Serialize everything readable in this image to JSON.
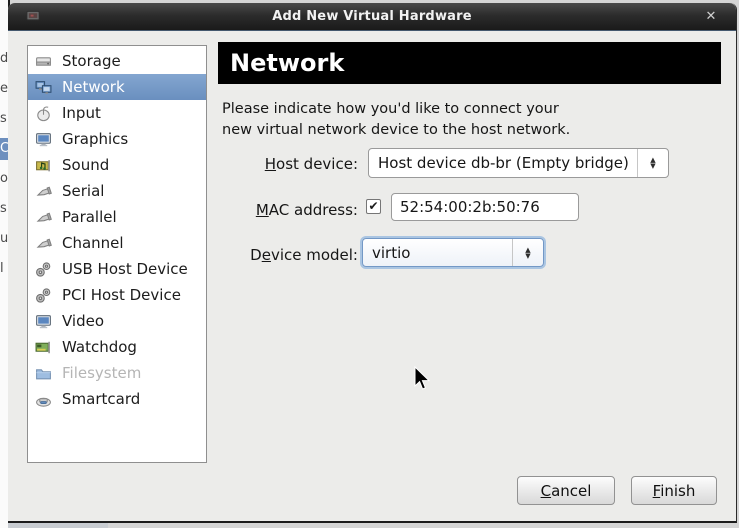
{
  "window": {
    "title": "Add New Virtual Hardware"
  },
  "icons": {
    "close": "✕",
    "checkmark": "✔",
    "spinner_up": "▲",
    "spinner_down": "▼"
  },
  "sidebar": {
    "items": [
      {
        "label": "Storage",
        "icon": "storage-icon",
        "glyph": "storage"
      },
      {
        "label": "Network",
        "icon": "network-icon",
        "glyph": "network",
        "selected": true
      },
      {
        "label": "Input",
        "icon": "input-mouse-icon",
        "glyph": "mouse"
      },
      {
        "label": "Graphics",
        "icon": "graphics-icon",
        "glyph": "monitor"
      },
      {
        "label": "Sound",
        "icon": "sound-icon",
        "glyph": "soundcard"
      },
      {
        "label": "Serial",
        "icon": "serial-icon",
        "glyph": "plug"
      },
      {
        "label": "Parallel",
        "icon": "parallel-icon",
        "glyph": "plug"
      },
      {
        "label": "Channel",
        "icon": "channel-icon",
        "glyph": "plug"
      },
      {
        "label": "USB Host Device",
        "icon": "usb-host-device-icon",
        "glyph": "gears"
      },
      {
        "label": "PCI Host Device",
        "icon": "pci-host-device-icon",
        "glyph": "gears"
      },
      {
        "label": "Video",
        "icon": "video-icon",
        "glyph": "monitor"
      },
      {
        "label": "Watchdog",
        "icon": "watchdog-icon",
        "glyph": "greencard"
      },
      {
        "label": "Filesystem",
        "icon": "filesystem-icon",
        "glyph": "folder",
        "enabled": false
      },
      {
        "label": "Smartcard",
        "icon": "smartcard-icon",
        "glyph": "cardreader"
      }
    ]
  },
  "main": {
    "heading": "Network",
    "instructions_line1": "Please indicate how you'd like to connect your",
    "instructions_line2": "new virtual network device to the host network.",
    "host_device": {
      "label_mn": "H",
      "label_rest": "ost device:",
      "value": "Host device db-br (Empty bridge)"
    },
    "mac_address": {
      "label_mn": "M",
      "label_rest": "AC address:",
      "checked": true,
      "value": "52:54:00:2b:50:76"
    },
    "device_model": {
      "label_pre": "D",
      "label_mn": "e",
      "label_rest": "vice model:",
      "value": "virtio"
    }
  },
  "footer": {
    "cancel_mn": "C",
    "cancel_rest": "ancel",
    "finish_mn": "F",
    "finish_rest": "inish"
  },
  "background": {
    "sliver_fragments": [
      {
        "ch": "d"
      },
      {
        "ch": "e"
      },
      {
        "ch": "s"
      },
      {
        "ch": "C",
        "hl": true
      },
      {
        "ch": "o"
      },
      {
        "ch": "s"
      },
      {
        "ch": "u"
      },
      {
        "ch": "l"
      }
    ]
  },
  "colors": {
    "selection_blue": "#7094c4",
    "banner_black": "#000000",
    "titlebar_dark": "#2b2b2b",
    "dialog_bg": "#ececea",
    "focus_ring": "#aac5e2"
  }
}
